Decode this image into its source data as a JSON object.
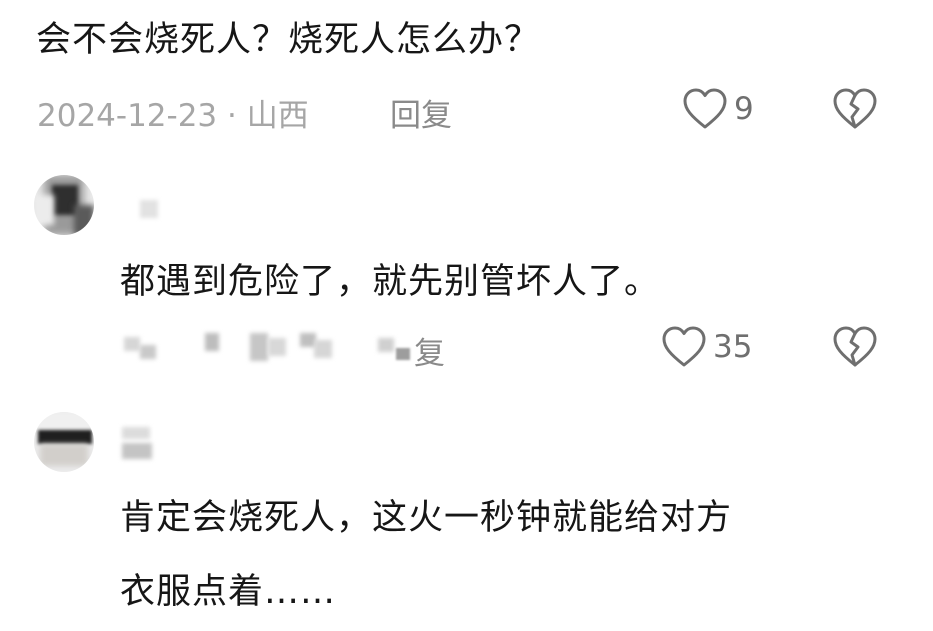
{
  "comments": [
    {
      "text": "会不会烧死人？烧死人怎么办？",
      "meta": "2024-12-23 · 山西",
      "reply_label": "回复",
      "like_count": "9"
    },
    {
      "text": "都遇到危险了，就先别管坏人了。",
      "reply_label_partial": "复",
      "like_count": "35"
    },
    {
      "text_line1": "肯定会烧死人，这火一秒钟就能给对方",
      "text_line2": "衣服点着……"
    }
  ],
  "icons": {
    "like": "heart-outline-icon",
    "dislike": "broken-heart-icon"
  },
  "colors": {
    "text": "#161616",
    "meta": "#a6a6a6",
    "icon": "#6f6f6f"
  }
}
